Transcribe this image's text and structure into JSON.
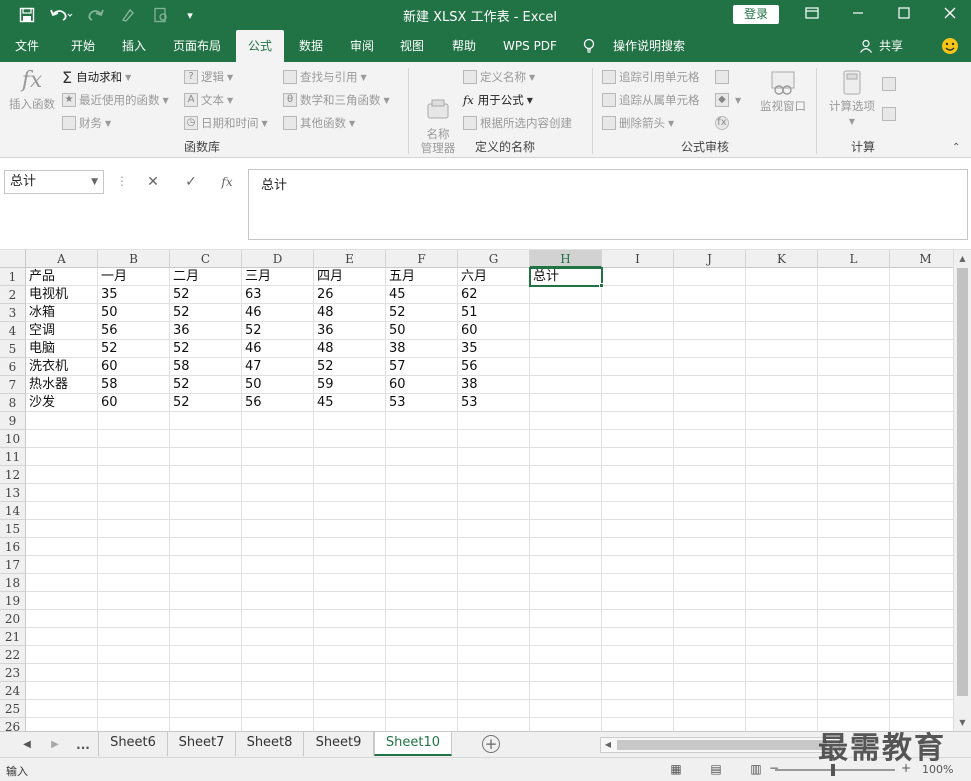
{
  "titlebar": {
    "title": "新建 XLSX 工作表  -  Excel",
    "login": "登录",
    "dropdown_glyph": "▾"
  },
  "tabs": [
    {
      "label": "文件"
    },
    {
      "label": "开始"
    },
    {
      "label": "插入"
    },
    {
      "label": "页面布局"
    },
    {
      "label": "公式"
    },
    {
      "label": "数据"
    },
    {
      "label": "审阅"
    },
    {
      "label": "视图"
    },
    {
      "label": "帮助"
    },
    {
      "label": "WPS PDF"
    },
    {
      "label": "操作说明搜索"
    }
  ],
  "share_label": "共享",
  "active_tab": "公式",
  "ribbon": {
    "insert_function": "插入函数",
    "fx_glyph": "fx",
    "autosum": "自动求和",
    "recent": "最近使用的函数",
    "financial": "财务",
    "logical": "逻辑",
    "text": "文本",
    "datetime": "日期和时间",
    "lookup": "查找与引用",
    "math": "数学和三角函数",
    "more": "其他函数",
    "group_library": "函数库",
    "name_manager": "名称\n管理器",
    "define_name": "定义名称",
    "use_in_formula": "用于公式",
    "create_from_sel": "根据所选内容创建",
    "group_names": "定义的名称",
    "trace_precedents": "追踪引用单元格",
    "trace_dependents": "追踪从属单元格",
    "remove_arrows": "删除箭头",
    "watch_window": "监视窗口",
    "group_audit": "公式审核",
    "calc_options": "计算选项",
    "group_calc": "计算"
  },
  "formula_bar": {
    "name_box": "总计",
    "fx_label": "fx",
    "content": "总计"
  },
  "grid": {
    "columns": [
      "A",
      "B",
      "C",
      "D",
      "E",
      "F",
      "G",
      "H",
      "I",
      "J",
      "K",
      "L",
      "M"
    ],
    "selected_column": "H",
    "row_count": 26,
    "rows": [
      [
        "产品",
        "一月",
        "二月",
        "三月",
        "四月",
        "五月",
        "六月",
        "总计"
      ],
      [
        "电视机",
        "35",
        "52",
        "63",
        "26",
        "45",
        "62"
      ],
      [
        "冰箱",
        "50",
        "52",
        "46",
        "48",
        "52",
        "51"
      ],
      [
        "空调",
        "56",
        "36",
        "52",
        "36",
        "50",
        "60"
      ],
      [
        "电脑",
        "52",
        "52",
        "46",
        "48",
        "38",
        "35"
      ],
      [
        "洗衣机",
        "60",
        "58",
        "47",
        "52",
        "57",
        "56"
      ],
      [
        "热水器",
        "58",
        "52",
        "50",
        "59",
        "60",
        "38"
      ],
      [
        "沙发",
        "60",
        "52",
        "56",
        "45",
        "53",
        "53"
      ]
    ]
  },
  "sheets": {
    "ellipsis": "...",
    "tabs": [
      "Sheet6",
      "Sheet7",
      "Sheet8",
      "Sheet9",
      "Sheet10"
    ],
    "active": "Sheet10"
  },
  "status": {
    "mode": "输入",
    "zoom": "100%"
  },
  "watermark": "最需教育"
}
